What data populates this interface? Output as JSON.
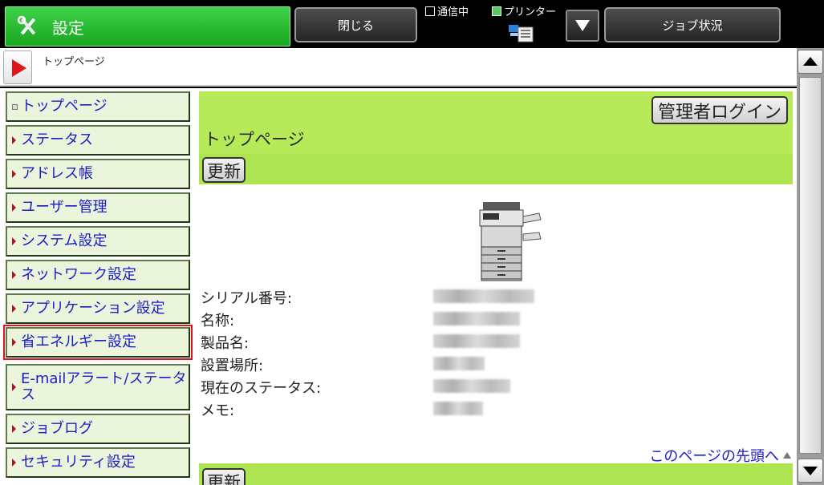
{
  "topbar": {
    "title": "設定",
    "close_label": "閉じる",
    "comm_label": "通信中",
    "printer_label": "プリンター",
    "job_status_label": "ジョブ状況"
  },
  "breadcrumb": {
    "path": "トップページ"
  },
  "nav": {
    "items": [
      {
        "label": "トップページ"
      },
      {
        "label": "ステータス"
      },
      {
        "label": "アドレス帳"
      },
      {
        "label": "ユーザー管理"
      },
      {
        "label": "システム設定"
      },
      {
        "label": "ネットワーク設定"
      },
      {
        "label": "アプリケーション設定"
      },
      {
        "label": "省エネルギー設定",
        "selected": true
      },
      {
        "label": "E-mailアラート/ステータス"
      },
      {
        "label": "ジョブログ"
      },
      {
        "label": "セキュリティ設定"
      }
    ]
  },
  "main": {
    "admin_login": "管理者ログイン",
    "heading": "トップページ",
    "refresh": "更新",
    "fields": [
      {
        "label": "シリアル番号:"
      },
      {
        "label": "名称:"
      },
      {
        "label": "製品名:"
      },
      {
        "label": "設置場所:"
      },
      {
        "label": "現在のステータス:"
      },
      {
        "label": "メモ:"
      }
    ],
    "page_top_link": "このページの先頭へ"
  },
  "colors": {
    "accent_green": "#15a81e",
    "header_green": "#b6ea58",
    "link_blue": "#1c1cc8",
    "selected_outline": "#e21318"
  }
}
